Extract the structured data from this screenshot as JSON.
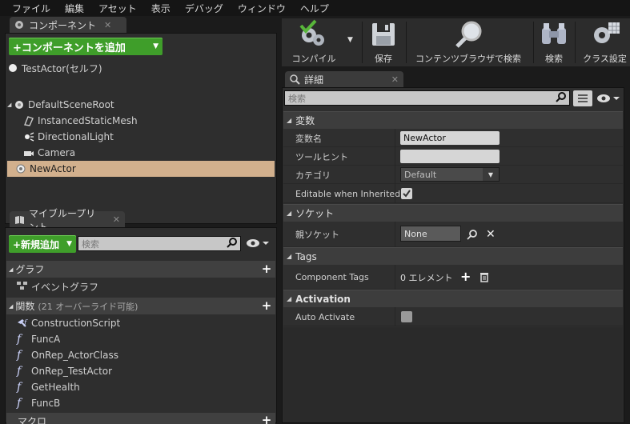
{
  "menubar": {
    "items": [
      "ファイル",
      "編集",
      "アセット",
      "表示",
      "デバッグ",
      "ウィンドウ",
      "ヘルプ"
    ]
  },
  "components_panel": {
    "tab_label": "コンポーネント",
    "add_button_label": "+コンポーネントを追加",
    "self_label": "TestActor(セルフ)",
    "tree": [
      {
        "label": "DefaultSceneRoot",
        "icon": "scene-root-icon"
      },
      {
        "label": "InstancedStaticMesh",
        "icon": "mesh-icon"
      },
      {
        "label": "DirectionalLight",
        "icon": "light-icon"
      },
      {
        "label": "Camera",
        "icon": "camera-icon"
      },
      {
        "label": "NewActor",
        "icon": "actor-icon",
        "selected": true
      }
    ]
  },
  "blueprint_panel": {
    "tab_label": "マイブループリント",
    "add_new_label": "+新規追加",
    "search_placeholder": "検索",
    "sections": {
      "graph": "グラフ",
      "event_graph": "イベントグラフ",
      "functions": "関数",
      "functions_note": "(21 オーバーライド可能)",
      "macros": "マクロ"
    },
    "functions": [
      "ConstructionScript",
      "FuncA",
      "OnRep_ActorClass",
      "OnRep_TestActor",
      "GetHealth",
      "FuncB"
    ]
  },
  "toolbar": {
    "compile": "コンパイル",
    "save": "保存",
    "content_browser": "コンテンツブラウザで検索",
    "search": "検索",
    "class_settings": "クラス設定"
  },
  "details_panel": {
    "tab_label": "詳細",
    "search_placeholder": "検索",
    "variables_section": "変数",
    "variable_name_label": "変数名",
    "variable_name_value": "NewActor",
    "tooltip_label": "ツールヒント",
    "tooltip_value": "",
    "category_label": "カテゴリ",
    "category_value": "Default",
    "editable_label": "Editable when Inherited",
    "socket_section": "ソケット",
    "parent_socket_label": "親ソケット",
    "parent_socket_value": "None",
    "tags_section": "Tags",
    "component_tags_label": "Component Tags",
    "component_tags_value": "0 エレメント",
    "activation_section": "Activation",
    "auto_activate_label": "Auto Activate"
  },
  "colors": {
    "accent_green": "#3f9e2a",
    "selection": "#d2b08d"
  }
}
